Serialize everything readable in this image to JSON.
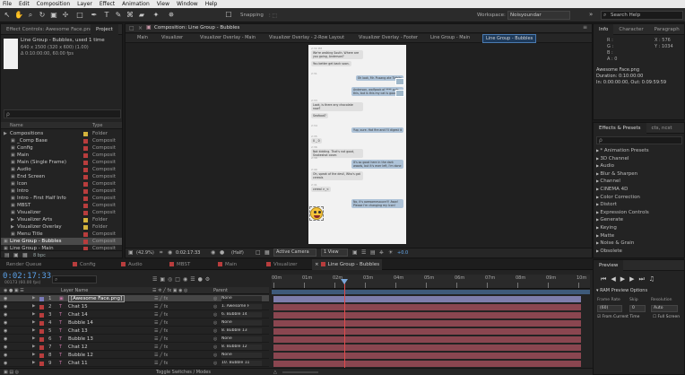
{
  "menu": [
    "File",
    "Edit",
    "Composition",
    "Layer",
    "Effect",
    "Animation",
    "View",
    "Window",
    "Help"
  ],
  "toolbar": {
    "snapping_label": "Snapping",
    "workspace_label": "Workspace:",
    "workspace_value": "Noisyoundar",
    "search_placeholder": "Search Help"
  },
  "effect_controls": {
    "tab_label": "Effect Controls: Awesome Face.png",
    "project_tab": "Project",
    "comp_name": "Line Group - Bubbles",
    "used_text": ", used 1 time",
    "size_text": "640 x 1500 (320 x 600) (1.00)",
    "duration_text": "Δ 0:10:00:00, 60.00 fps",
    "search_placeholder": "ρ"
  },
  "project": {
    "col_name": "Name",
    "col_type": "Type",
    "items": [
      {
        "name": "Compositions",
        "type": "Folder",
        "color": "#d4b33c",
        "indent": 0,
        "folder": true
      },
      {
        "name": "_Comp Base",
        "type": "Composit",
        "color": "#b83d3d",
        "indent": 1
      },
      {
        "name": "Config",
        "type": "Composit",
        "color": "#b83d3d",
        "indent": 1
      },
      {
        "name": "Main",
        "type": "Composit",
        "color": "#b83d3d",
        "indent": 1
      },
      {
        "name": "Main (Single Frame)",
        "type": "Composit",
        "color": "#b83d3d",
        "indent": 1
      },
      {
        "name": "Audio",
        "type": "Composit",
        "color": "#b83d3d",
        "indent": 1
      },
      {
        "name": "End Screen",
        "type": "Composit",
        "color": "#b83d3d",
        "indent": 1
      },
      {
        "name": "Icon",
        "type": "Composit",
        "color": "#b83d3d",
        "indent": 1
      },
      {
        "name": "Intro",
        "type": "Composit",
        "color": "#b83d3d",
        "indent": 1
      },
      {
        "name": "Intro - First Half Info",
        "type": "Composit",
        "color": "#b83d3d",
        "indent": 1
      },
      {
        "name": "MBST",
        "type": "Composit",
        "color": "#b83d3d",
        "indent": 1
      },
      {
        "name": "Visualizer",
        "type": "Composit",
        "color": "#b83d3d",
        "indent": 1
      },
      {
        "name": "Visualizer Arts",
        "type": "Folder",
        "color": "#d4b33c",
        "indent": 1,
        "folder": true
      },
      {
        "name": "Visualizer Overlay",
        "type": "Folder",
        "color": "#d4b33c",
        "indent": 1,
        "folder": true
      },
      {
        "name": "Menu Title",
        "type": "Composit",
        "color": "#b83d3d",
        "indent": 1
      },
      {
        "name": "Line Group - Bubbles",
        "type": "Composit",
        "color": "#b83d3d",
        "indent": 0,
        "selected": true
      },
      {
        "name": "Line Group - Main",
        "type": "Composit",
        "color": "#b83d3d",
        "indent": 0
      }
    ],
    "footer_text": "8 bpc"
  },
  "composition": {
    "tab_label": "Composition: Line Group - Bubbles",
    "tabs": [
      "Main",
      "Visualizer",
      "Visualizer Overlay - Main",
      "Visualizer Overlay - 2-Row Layout",
      "Visualizer Overlay - Footer",
      "Line Group - Main",
      "Line Group - Bubbles"
    ],
    "active_tab": 6
  },
  "chat": [
    {
      "side": "l",
      "text": "We're walking South. Where are you going, Anderson?"
    },
    {
      "side": "l",
      "text": "You better get back soon."
    },
    {
      "side": "r",
      "text": "Oh look, Mr. Pusang ate Tidbits"
    },
    {
      "side": "r",
      "text": "Anderson, wolfpack of **** puts this, but is this my cat is good"
    },
    {
      "side": "l",
      "text": "Look, is there any chocolate now?"
    },
    {
      "side": "l",
      "text": "Seafood?"
    },
    {
      "side": "r",
      "text": "Yup, sure. Hot fire and I'll digest it"
    },
    {
      "side": "l",
      "text": "0 _ 0"
    },
    {
      "side": "l",
      "text": "Not kidding. That's not good, Snakeshot cover."
    },
    {
      "side": "r",
      "text": "It's so good here in the dark woods, but it's ever left, I'm done"
    },
    {
      "side": "l",
      "text": "Oh, speak of the devil, Who's got cereals"
    },
    {
      "side": "l",
      "text": "cereal >_<"
    },
    {
      "side": "r",
      "text": "No, it's awesomesauce!!! Aww! Please I'm changing my Icon!"
    }
  ],
  "chat_times": [
    "2:30 PM",
    "2:31",
    "2:33",
    "2:34",
    "2:35",
    "2:36",
    "2:38",
    "2:40",
    "2:41"
  ],
  "viewer_controls": {
    "zoom": "(42.9%)",
    "timecode": "0:02:17:33",
    "resolution": "(Half)",
    "camera": "Active Camera",
    "view": "1 View",
    "offset": "+0.0"
  },
  "info_panel": {
    "tabs": [
      "Info",
      "Character",
      "Paragraph"
    ],
    "r_label": "R :",
    "g_label": "G :",
    "b_label": "B :",
    "a_label": "A : 0",
    "x_value": "X : 576",
    "y_value": "Y : 1034",
    "file_name": "Awesome Face.png",
    "duration": "Duration: 0:10:00:00",
    "in_out": "In: 0:00:00:00, Out: 0:09:59:59"
  },
  "effects": {
    "tabs": [
      "Effects & Presets",
      "cts, ncst"
    ],
    "search_placeholder": "ρ",
    "items": [
      "* Animation Presets",
      "3D Channel",
      "Audio",
      "Blur & Sharpen",
      "Channel",
      "CINEMA 4D",
      "Color Correction",
      "Distort",
      "Expression Controls",
      "Generate",
      "Keying",
      "Matte",
      "Noise & Grain",
      "Obsolete"
    ]
  },
  "timeline": {
    "tabs": [
      "Render Queue",
      "Config",
      "Audio",
      "MBST",
      "Main",
      "Visualizer",
      "Line Group - Bubbles"
    ],
    "active_tab": 6,
    "timecode": "0:02:17:33",
    "frame_info": "00173 (60.00 fps)",
    "col_layer": "Layer Name",
    "col_parent": "Parent",
    "ruler": [
      "00m",
      "01m",
      "02m",
      "03m",
      "04m",
      "05m",
      "06m",
      "07m",
      "08m",
      "09m",
      "10m"
    ],
    "layers": [
      {
        "num": "1",
        "name": "[Awesome Face.png]",
        "color": "#7a7ab8",
        "parent": "None",
        "selected": true
      },
      {
        "num": "2",
        "name": "Chat 15",
        "color": "#b83d3d",
        "parent": "1. Awesome F"
      },
      {
        "num": "3",
        "name": "Chat 14",
        "color": "#b83d3d",
        "parent": "6. Bubble 14"
      },
      {
        "num": "4",
        "name": "Bubble 14",
        "color": "#b83d3d",
        "parent": "None"
      },
      {
        "num": "5",
        "name": "Chat 13",
        "color": "#b83d3d",
        "parent": "8. Bubble 13"
      },
      {
        "num": "6",
        "name": "Bubble 13",
        "color": "#b83d3d",
        "parent": "None"
      },
      {
        "num": "7",
        "name": "Chat 12",
        "color": "#b83d3d",
        "parent": "8. Bubble 12"
      },
      {
        "num": "8",
        "name": "Bubble 12",
        "color": "#b83d3d",
        "parent": "None"
      },
      {
        "num": "9",
        "name": "Chat 11",
        "color": "#b83d3d",
        "parent": "10. Bubble 11"
      }
    ],
    "footer_label": "Toggle Switches / Modes"
  },
  "preview": {
    "tab": "Preview",
    "ram_options": "RAM Preview Options",
    "frame_rate_label": "Frame Rate",
    "skip_label": "Skip",
    "resolution_label": "Resolution",
    "frame_rate_value": "(60)",
    "skip_value": "0",
    "resolution_value": "Auto",
    "from_current": "From Current Time",
    "full_screen": "Full Screen"
  }
}
